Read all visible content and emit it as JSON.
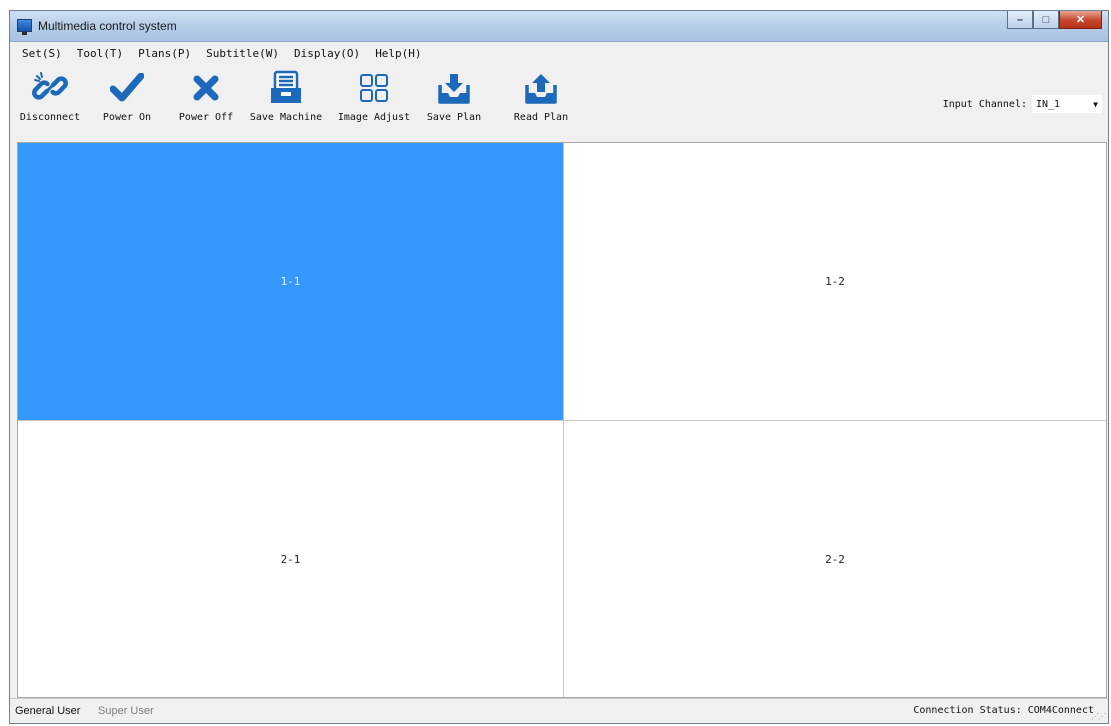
{
  "window": {
    "title": "Multimedia control system",
    "controls": {
      "minimize": "–",
      "maximize": "□",
      "close": "✕"
    }
  },
  "menu": [
    {
      "label": "Set(S)"
    },
    {
      "label": "Tool(T)"
    },
    {
      "label": "Plans(P)"
    },
    {
      "label": "Subtitle(W)"
    },
    {
      "label": "Display(O)"
    },
    {
      "label": "Help(H)"
    }
  ],
  "toolbar": {
    "disconnect": {
      "label": "Disconnect",
      "icon": "link-icon"
    },
    "power_on": {
      "label": "Power On",
      "icon": "checkmark-icon"
    },
    "power_off": {
      "label": "Power Off",
      "icon": "x-icon"
    },
    "save_machine": {
      "label": "Save Machine",
      "icon": "save-machine-icon"
    },
    "image_adjust": {
      "label": "Image Adjust",
      "icon": "grid-icon"
    },
    "save_plan": {
      "label": "Save Plan",
      "icon": "download-tray-icon"
    },
    "read_plan": {
      "label": "Read Plan",
      "icon": "upload-tray-icon"
    },
    "accent_color": "#1b69b8"
  },
  "input_channel": {
    "label": "Input Channel:",
    "value": "IN_1"
  },
  "grid": {
    "cells": [
      {
        "label": "1-1",
        "selected": true
      },
      {
        "label": "1-2",
        "selected": false
      },
      {
        "label": "2-1",
        "selected": false
      },
      {
        "label": "2-2",
        "selected": false
      }
    ],
    "selected_color": "#3498ff"
  },
  "status": {
    "general_user": "General User",
    "super_user": "Super User",
    "connection": "Connection Status:  COM4Connect"
  }
}
